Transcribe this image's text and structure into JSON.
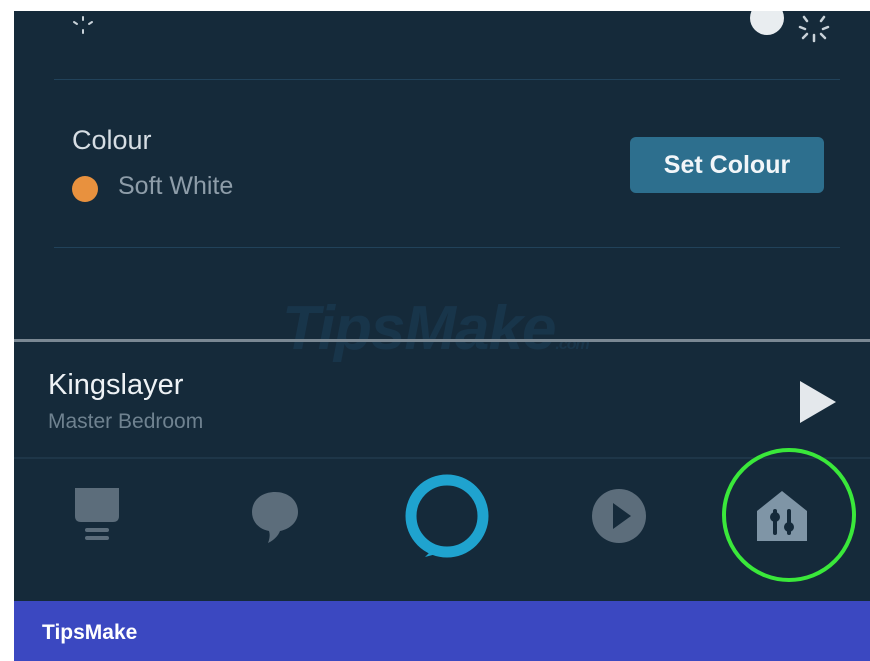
{
  "colour": {
    "title": "Colour",
    "value": "Soft White",
    "swatch_color": "#e8913e",
    "button_label": "Set Colour"
  },
  "now_playing": {
    "title": "Kingslayer",
    "device": "Master Bedroom"
  },
  "nav": {
    "items": [
      {
        "name": "home",
        "icon": "home-icon"
      },
      {
        "name": "communicate",
        "icon": "speech-bubble-icon"
      },
      {
        "name": "alexa",
        "icon": "alexa-ring-icon"
      },
      {
        "name": "play",
        "icon": "play-circle-icon"
      },
      {
        "name": "devices",
        "icon": "devices-icon",
        "highlighted": true
      }
    ]
  },
  "colors": {
    "background": "#152a3a",
    "accent": "#1fa3cf",
    "button": "#2d6f8e",
    "highlight_ring": "#3ae83a"
  },
  "watermark": {
    "text": "TipsMake",
    "suffix": ".com"
  },
  "footer": {
    "brand": "TipsMake"
  }
}
